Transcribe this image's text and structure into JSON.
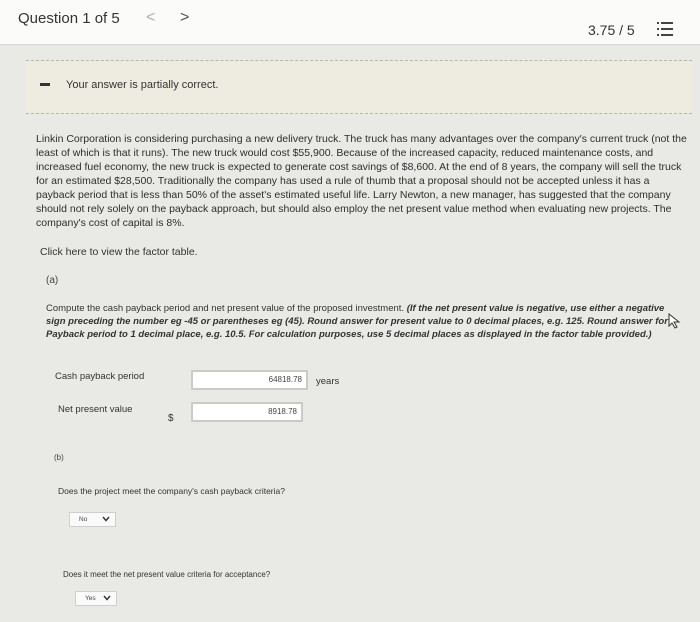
{
  "header": {
    "question_label": "Question 1 of 5",
    "prev_arrow": "<",
    "next_arrow": ">",
    "score": "3.75 / 5",
    "menu_icon": "list-icon"
  },
  "feedback": {
    "text": "Your answer is partially correct."
  },
  "problem": {
    "text": "Linkin Corporation is considering purchasing a new delivery truck. The truck has many advantages over the company's current truck (not the least of which is that it runs). The new truck would cost $55,900. Because of the increased capacity, reduced maintenance costs, and increased fuel economy, the new truck is expected to generate cost savings of $8,600. At the end of 8 years, the company will sell the truck for an estimated $28,500. Traditionally the company has used a rule of thumb that a proposal should not be accepted unless it has a payback period that is less than 50% of the asset's estimated useful life. Larry Newton, a new manager, has suggested that the company should not rely solely on the payback approach, but should also employ the net present value method when evaluating new projects. The company's cost of capital is 8%.",
    "factor_link": "Click here to view the factor table."
  },
  "part_a": {
    "label": "(a)",
    "instruction_plain": "Compute the cash payback period and net present value of the proposed investment. ",
    "instruction_emphasis": "(If the net present value is negative, use either a negative sign preceding the number eg -45 or parentheses eg (45). Round answer for present value to 0 decimal places, e.g. 125. Round answer for Payback period to 1 decimal place, e.g. 10.5. For calculation purposes, use 5 decimal places as displayed in the factor table provided.)",
    "payback_label": "Cash payback period",
    "payback_value": "64818.78",
    "payback_unit": "years",
    "npv_label": "Net present value",
    "currency": "$",
    "npv_value": "8918.78"
  },
  "part_b": {
    "label": "(b)",
    "payback_question": "Does the project meet the company's cash payback criteria?",
    "payback_answer": "No",
    "npv_question": "Does it meet the net present value criteria for acceptance?",
    "npv_answer": "Yes"
  }
}
